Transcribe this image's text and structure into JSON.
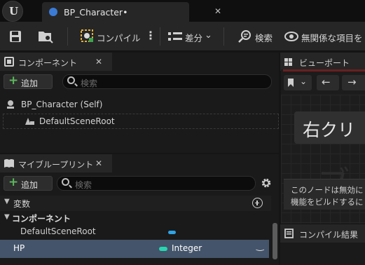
{
  "document_tab": {
    "title": "BP_Character",
    "modified_mark": "•",
    "close": "✕"
  },
  "toolbar": {
    "compile_label": "コンパイル",
    "diff_label": "差分",
    "search_label": "検索",
    "unrelated_label": "無関係な項目を"
  },
  "components_panel": {
    "title": "コンポーネント",
    "close": "✕",
    "add_label": "追加",
    "search_placeholder": "検索",
    "tree": [
      {
        "label": "BP_Character (Self)"
      },
      {
        "label": "DefaultSceneRoot"
      }
    ]
  },
  "my_blueprint_panel": {
    "title": "マイブループリント",
    "close": "✕",
    "add_label": "追加",
    "search_placeholder": "検索",
    "variables_header": "変数",
    "components_header": "コンポーネント",
    "rows": [
      {
        "name": "DefaultSceneRoot",
        "type": "",
        "type_color": "#2ea3e6"
      },
      {
        "name": "HP",
        "type": "Integer",
        "type_color": "#26d6b0"
      }
    ]
  },
  "viewport_panel": {
    "title": "ビューポート",
    "overlay_text": "右クリ",
    "big_glyph": "ブ",
    "notice_line1": "このノードは無効に",
    "notice_line2": "機能をビルドするに"
  },
  "compile_results_panel": {
    "title": "コンパイル結果"
  },
  "colors": {
    "add_plus": "#5cb85c",
    "integer_pin": "#26d6b0",
    "component_pin": "#2ea3e6",
    "selected_row": "#44546a"
  }
}
